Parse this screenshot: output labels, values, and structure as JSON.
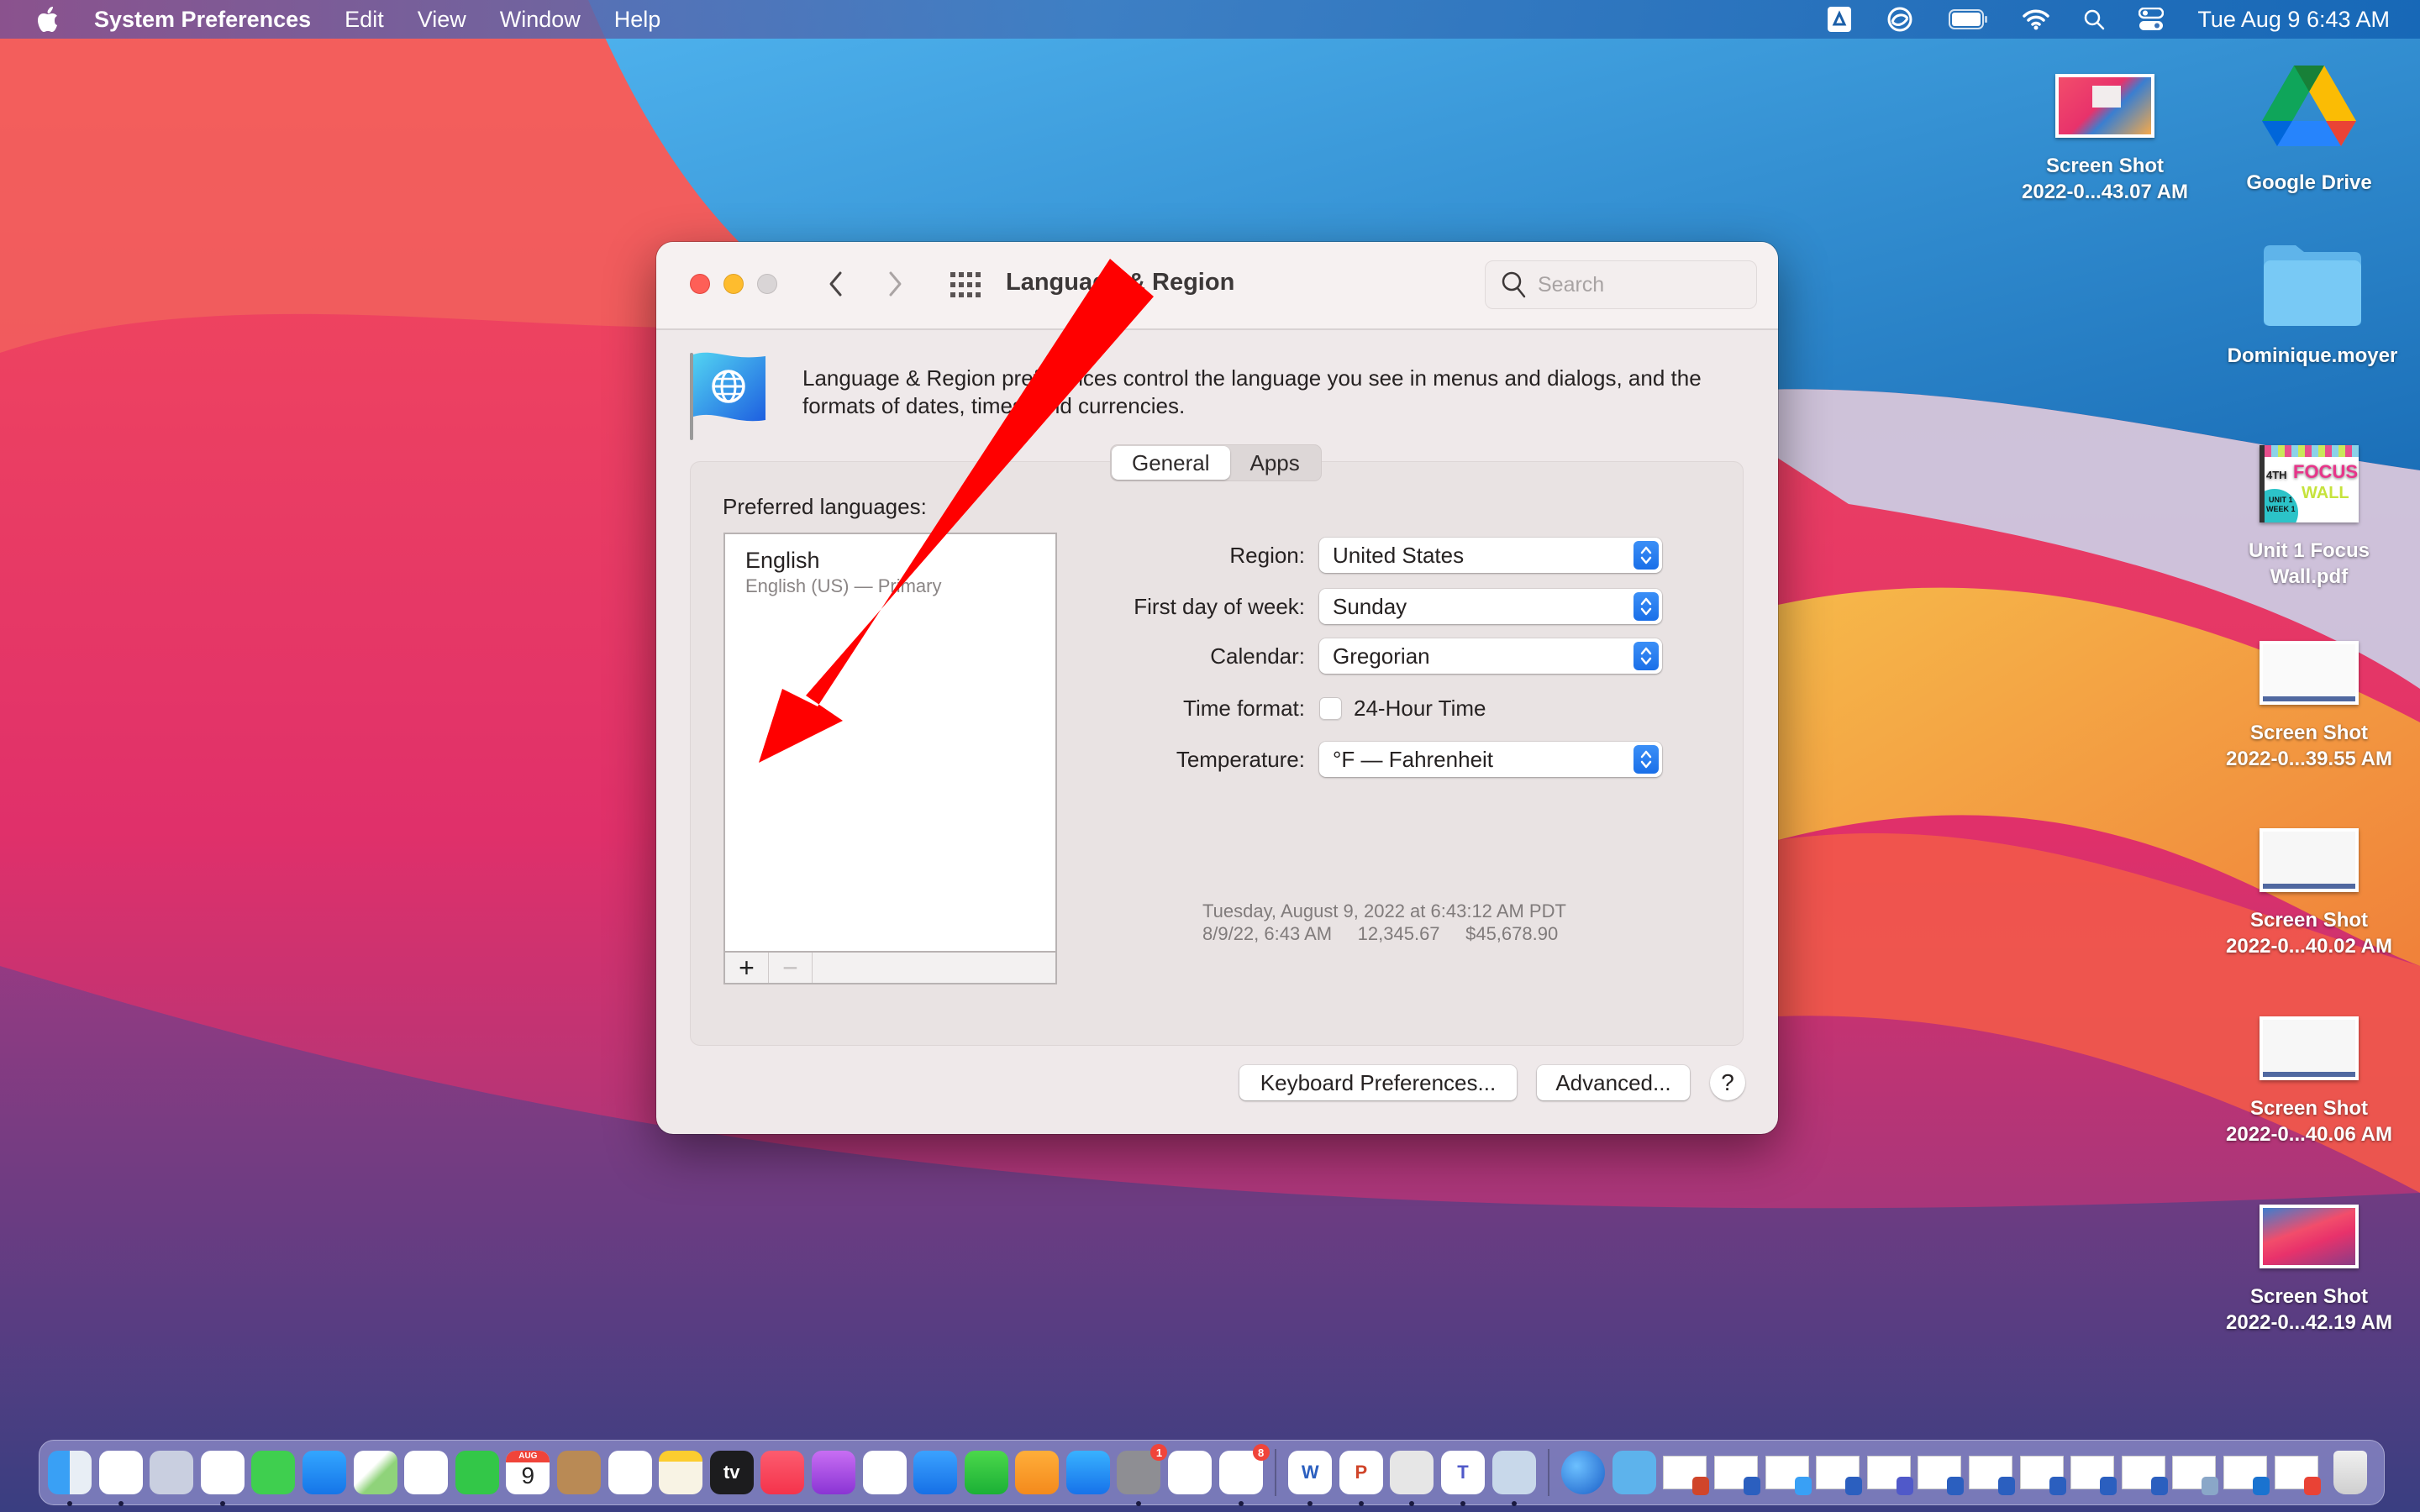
{
  "menubar": {
    "app_name": "System Preferences",
    "menus": [
      "Edit",
      "View",
      "Window",
      "Help"
    ],
    "status_icons": [
      "google-drive-sync-icon",
      "creative-cloud-icon",
      "battery-icon",
      "wifi-icon",
      "spotlight-search-icon",
      "control-center-icon"
    ],
    "clock": "Tue Aug 9  6:43 AM"
  },
  "desktop": {
    "icons": [
      {
        "label_line1": "Screen Shot",
        "label_line2": "2022-0...43.07 AM",
        "type": "screenshot"
      },
      {
        "label_line1": "Google Drive",
        "label_line2": "",
        "type": "google-drive"
      },
      {
        "label_line1": "Dominique.moyer",
        "label_line2": "",
        "type": "folder"
      },
      {
        "label_line1": "Unit 1 Focus",
        "label_line2": "Wall.pdf",
        "type": "pdf"
      },
      {
        "label_line1": "Screen Shot",
        "label_line2": "2022-0...39.55 AM",
        "type": "screenshot"
      },
      {
        "label_line1": "Screen Shot",
        "label_line2": "2022-0...40.02 AM",
        "type": "screenshot"
      },
      {
        "label_line1": "Screen Shot",
        "label_line2": "2022-0...40.06 AM",
        "type": "screenshot"
      },
      {
        "label_line1": "Screen Shot",
        "label_line2": "2022-0...42.19 AM",
        "type": "screenshot"
      }
    ],
    "pdf_thumb_text": {
      "grade": "4TH",
      "title1": "FOCUS",
      "title2": "WALL",
      "unit": "UNIT 1",
      "week": "WEEK 1"
    }
  },
  "window": {
    "title": "Language & Region",
    "search_placeholder": "Search",
    "description": "Language & Region preferences control the language you see in menus and dialogs, and the formats of dates, times, and currencies.",
    "tabs": [
      {
        "label": "General",
        "active": true
      },
      {
        "label": "Apps",
        "active": false
      }
    ],
    "preferred_languages_label": "Preferred languages:",
    "languages": [
      {
        "name": "English",
        "detail": "English (US) — Primary"
      }
    ],
    "add_button": "+",
    "remove_button": "−",
    "fields": {
      "region": {
        "label": "Region:",
        "value": "United States"
      },
      "first_day": {
        "label": "First day of week:",
        "value": "Sunday"
      },
      "calendar": {
        "label": "Calendar:",
        "value": "Gregorian"
      },
      "time_format": {
        "label": "Time format:",
        "checkbox_label": "24-Hour Time",
        "checked": false
      },
      "temperature": {
        "label": "Temperature:",
        "value": "°F — Fahrenheit"
      }
    },
    "sample": {
      "line1": "Tuesday, August 9, 2022 at 6:43:12 AM PDT",
      "line2": "8/9/22, 6:43 AM     12,345.67     $45,678.90"
    },
    "buttons": {
      "keyboard": "Keyboard Preferences...",
      "advanced": "Advanced...",
      "help": "?"
    },
    "annotation_color": "#ff0000"
  },
  "dock": {
    "apps": [
      {
        "name": "Finder",
        "running": true
      },
      {
        "name": "Google Chrome",
        "running": true
      },
      {
        "name": "Launchpad",
        "running": false
      },
      {
        "name": "Safari",
        "running": true
      },
      {
        "name": "Messages",
        "running": false
      },
      {
        "name": "Mail",
        "running": false
      },
      {
        "name": "Maps",
        "running": false
      },
      {
        "name": "Photos",
        "running": false
      },
      {
        "name": "FaceTime",
        "running": false
      },
      {
        "name": "Calendar",
        "running": false,
        "month": "AUG",
        "day": "9"
      },
      {
        "name": "Contacts",
        "running": false
      },
      {
        "name": "Reminders",
        "running": false
      },
      {
        "name": "Notes",
        "running": false
      },
      {
        "name": "Apple TV",
        "running": false,
        "glyph": "tv"
      },
      {
        "name": "Music",
        "running": false
      },
      {
        "name": "Podcasts",
        "running": false
      },
      {
        "name": "News",
        "running": false
      },
      {
        "name": "Keynote",
        "running": false
      },
      {
        "name": "Numbers",
        "running": false
      },
      {
        "name": "Pages",
        "running": false
      },
      {
        "name": "App Store",
        "running": false
      },
      {
        "name": "System Preferences",
        "running": true,
        "badge": "1"
      },
      {
        "name": "Presentation App",
        "running": false
      },
      {
        "name": "Microsoft Outlook",
        "running": true,
        "badge": "8"
      }
    ],
    "apps2": [
      {
        "name": "Microsoft Word",
        "running": true,
        "glyph": "W"
      },
      {
        "name": "Microsoft PowerPoint",
        "running": true,
        "glyph": "P"
      },
      {
        "name": "Printer",
        "running": true
      },
      {
        "name": "Microsoft Teams",
        "running": true,
        "glyph": "T"
      },
      {
        "name": "Preview",
        "running": true
      }
    ],
    "others": [
      "Network",
      "Downloads folder"
    ],
    "minimized_windows": [
      "powerpoint",
      "word",
      "finder",
      "word",
      "teams",
      "word",
      "word",
      "word",
      "word",
      "word",
      "preview",
      "outlook",
      "chrome"
    ],
    "trash": "Trash"
  }
}
